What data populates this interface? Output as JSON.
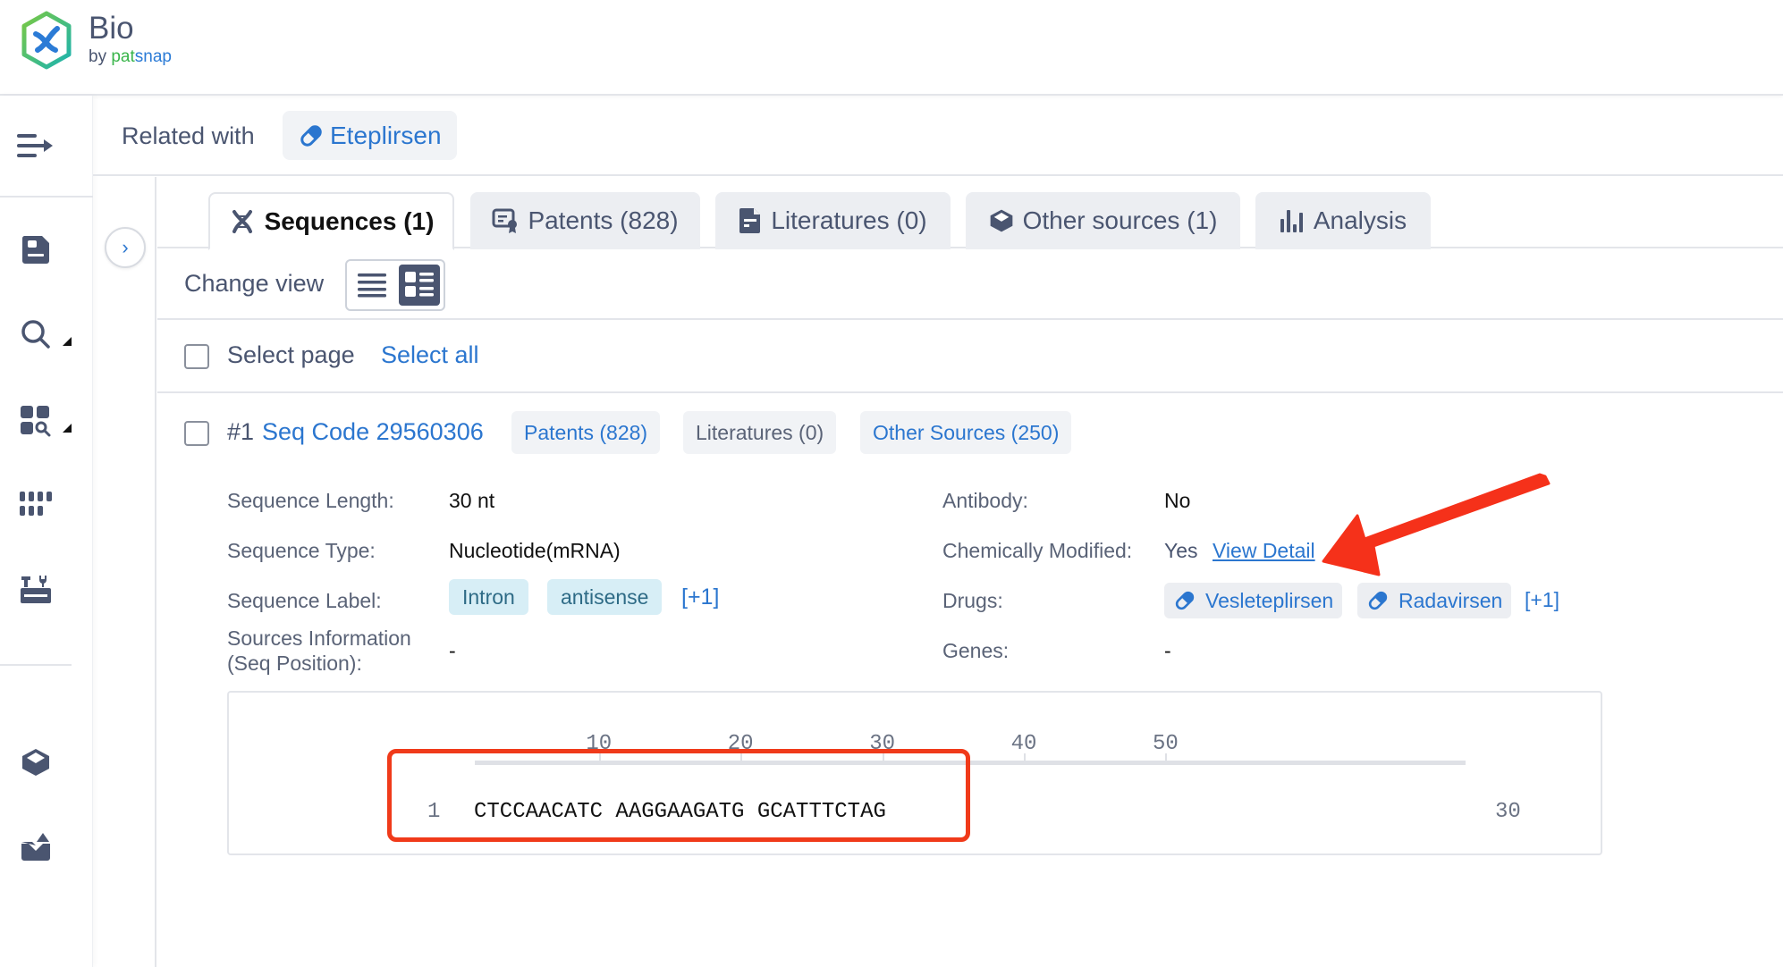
{
  "app": {
    "logo_title": "Bio",
    "logo_by": "by",
    "logo_brand_a": "pat",
    "logo_brand_b": "snap"
  },
  "sidebar": {
    "items": [
      {
        "icon": "menu-expand-icon"
      },
      {
        "icon": "saved-document-icon"
      },
      {
        "icon": "search-icon",
        "has_submenu": true
      },
      {
        "icon": "grid-search-icon",
        "has_submenu": true
      },
      {
        "icon": "apps-grid-icon"
      },
      {
        "icon": "toolbox-icon"
      },
      {
        "icon": "cube-icon"
      },
      {
        "icon": "inbox-export-icon"
      }
    ]
  },
  "related": {
    "label": "Related with",
    "entity": "Eteplirsen",
    "entity_icon": "pill-icon"
  },
  "tabs": [
    {
      "label": "Sequences (1)",
      "icon": "dna-icon",
      "active": true
    },
    {
      "label": "Patents (828)",
      "icon": "patent-icon",
      "active": false
    },
    {
      "label": "Literatures (0)",
      "icon": "document-icon",
      "active": false
    },
    {
      "label": "Other sources (1)",
      "icon": "cube-icon",
      "active": false
    },
    {
      "label": "Analysis",
      "icon": "bar-chart-icon",
      "active": false
    }
  ],
  "view": {
    "label": "Change view",
    "modes": [
      "list",
      "card"
    ],
    "selected": "card"
  },
  "selection": {
    "select_page": "Select page",
    "select_all": "Select all"
  },
  "record": {
    "index": "#1",
    "code": "Seq Code 29560306",
    "chips": [
      {
        "label": "Patents (828)",
        "active": true
      },
      {
        "label": "Literatures (0)",
        "active": false
      },
      {
        "label": "Other Sources (250)",
        "active": true
      }
    ],
    "fields": {
      "length_label": "Sequence Length:",
      "length_value": "30 nt",
      "type_label": "Sequence Type:",
      "type_value": "Nucleotide(mRNA)",
      "label_label": "Sequence Label:",
      "labels": [
        "Intron",
        "antisense"
      ],
      "labels_more": "[+1]",
      "sources_label_1": "Sources Information",
      "sources_label_2": "(Seq Position):",
      "sources_value": "-",
      "antibody_label": "Antibody:",
      "antibody_value": "No",
      "chem_label": "Chemically Modified:",
      "chem_value": "Yes",
      "chem_link": "View Detail",
      "drugs_label": "Drugs:",
      "drugs": [
        "Vesleteplirsen",
        "Radavirsen"
      ],
      "drugs_more": "[+1]",
      "genes_label": "Genes:",
      "genes_value": "-"
    },
    "sequence": {
      "ruler_ticks": [
        "10",
        "20",
        "30",
        "40",
        "50"
      ],
      "start": "1",
      "text": "CTCCAACATC AAGGAAGATG GCATTTCTAG",
      "end": "30"
    }
  },
  "annotations": {
    "highlight_color": "#f03a1a",
    "arrow_color": "#f5311a"
  },
  "colors": {
    "accent": "#2b76cf",
    "text": "#4a5570",
    "tab_bg": "#eceef2",
    "tag_bg": "#d7eef6"
  }
}
